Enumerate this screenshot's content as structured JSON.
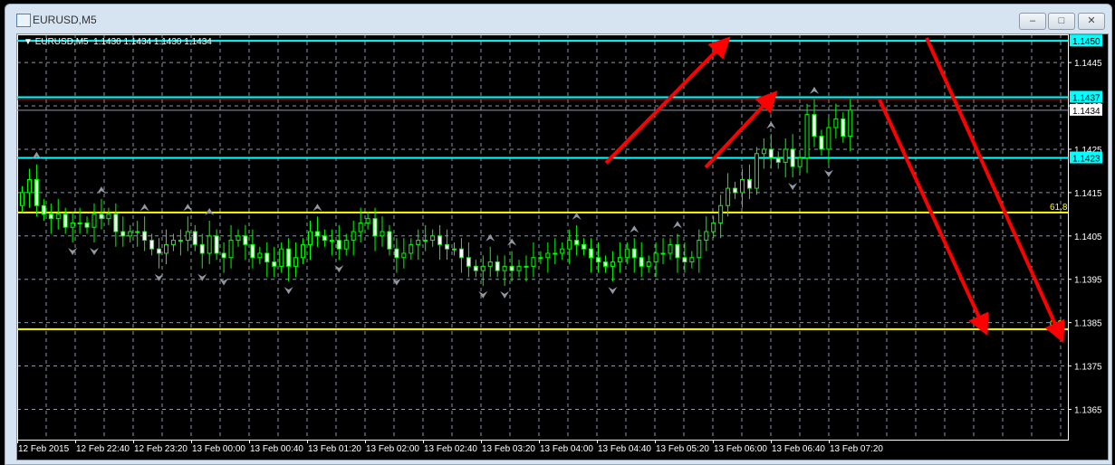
{
  "window": {
    "title": "EURUSD,M5",
    "minimize": "–",
    "maximize": "□",
    "close": "✕"
  },
  "chart_info": {
    "caret": "▼",
    "symbol": "EURUSD,M5",
    "ohlc": "1.1430 1.1434 1.1430 1.1434"
  },
  "colors": {
    "bull_outline": "#00ff00",
    "bear_body": "#ffffff",
    "level_cyan": "#00ffff",
    "fib_yellow": "#ffff00",
    "arrow_red": "#ff0000",
    "grid": "#8a96a8"
  },
  "chart_data": {
    "type": "candlestick",
    "symbol": "EURUSD",
    "timeframe": "M5",
    "ylim": [
      1.1358,
      1.14515
    ],
    "y_ticks": [
      "1.1445",
      "1.1435",
      "1.1425",
      "1.1415",
      "1.1405",
      "1.1395",
      "1.1385",
      "1.1375",
      "1.1365"
    ],
    "x_ticks": [
      "12 Feb 2015",
      "12 Feb 22:40",
      "12 Feb 23:20",
      "13 Feb 00:00",
      "13 Feb 00:40",
      "13 Feb 01:20",
      "13 Feb 02:00",
      "13 Feb 02:40",
      "13 Feb 03:20",
      "13 Feb 04:00",
      "13 Feb 04:40",
      "13 Feb 05:20",
      "13 Feb 06:00",
      "13 Feb 06:40",
      "13 Feb 07:20"
    ],
    "first_open": 1.1412,
    "close": [
      1.1415,
      1.1418,
      1.1412,
      1.141,
      1.1409,
      1.141,
      1.1407,
      1.1408,
      1.1408,
      1.1407,
      1.141,
      1.1409,
      1.141,
      1.1406,
      1.1405,
      1.1406,
      1.1406,
      1.1404,
      1.1402,
      1.1401,
      1.1403,
      1.1404,
      1.1404,
      1.1406,
      1.1403,
      1.1401,
      1.1405,
      1.1401,
      1.14,
      1.1404,
      1.1405,
      1.1403,
      1.14,
      1.1401,
      1.1399,
      1.1398,
      1.1402,
      1.1398,
      1.14,
      1.1403,
      1.1406,
      1.1405,
      1.1404,
      1.1404,
      1.1402,
      1.1404,
      1.1406,
      1.1408,
      1.1409,
      1.1405,
      1.1406,
      1.1402,
      1.14,
      1.1401,
      1.1403,
      1.1404,
      1.1404,
      1.1405,
      1.1403,
      1.1402,
      1.1402,
      1.14,
      1.1398,
      1.1397,
      1.1398,
      1.1399,
      1.1397,
      1.1398,
      1.1397,
      1.1398,
      1.1398,
      1.14,
      1.14,
      1.1401,
      1.1401,
      1.1402,
      1.1404,
      1.1403,
      1.1402,
      1.14,
      1.1399,
      1.1398,
      1.1399,
      1.14,
      1.1402,
      1.14,
      1.1398,
      1.1399,
      1.1401,
      1.1401,
      1.1403,
      1.14,
      1.1399,
      1.14,
      1.1404,
      1.1406,
      1.1408,
      1.1412,
      1.1416,
      1.1415,
      1.1418,
      1.1416,
      1.1424,
      1.1425,
      1.1423,
      1.1422,
      1.1425,
      1.1421,
      1.1423,
      1.1433,
      1.1428,
      1.1425,
      1.143,
      1.1432,
      1.1428,
      1.1434
    ],
    "levels": [
      {
        "price": 1.145,
        "label": "1.1450",
        "color": "#00ffff",
        "boxed": true
      },
      {
        "price": 1.1437,
        "label": "1.1437",
        "color": "#00ffff",
        "boxed": true
      },
      {
        "price": 1.1423,
        "label": "1.1423",
        "color": "#00ffff",
        "boxed": true
      }
    ],
    "bid": {
      "price": 1.1434,
      "label": "1.1434"
    },
    "fibo": [
      {
        "price": 1.14104,
        "label": "61.8"
      },
      {
        "price": 1.13835,
        "label": "0.0"
      }
    ]
  }
}
